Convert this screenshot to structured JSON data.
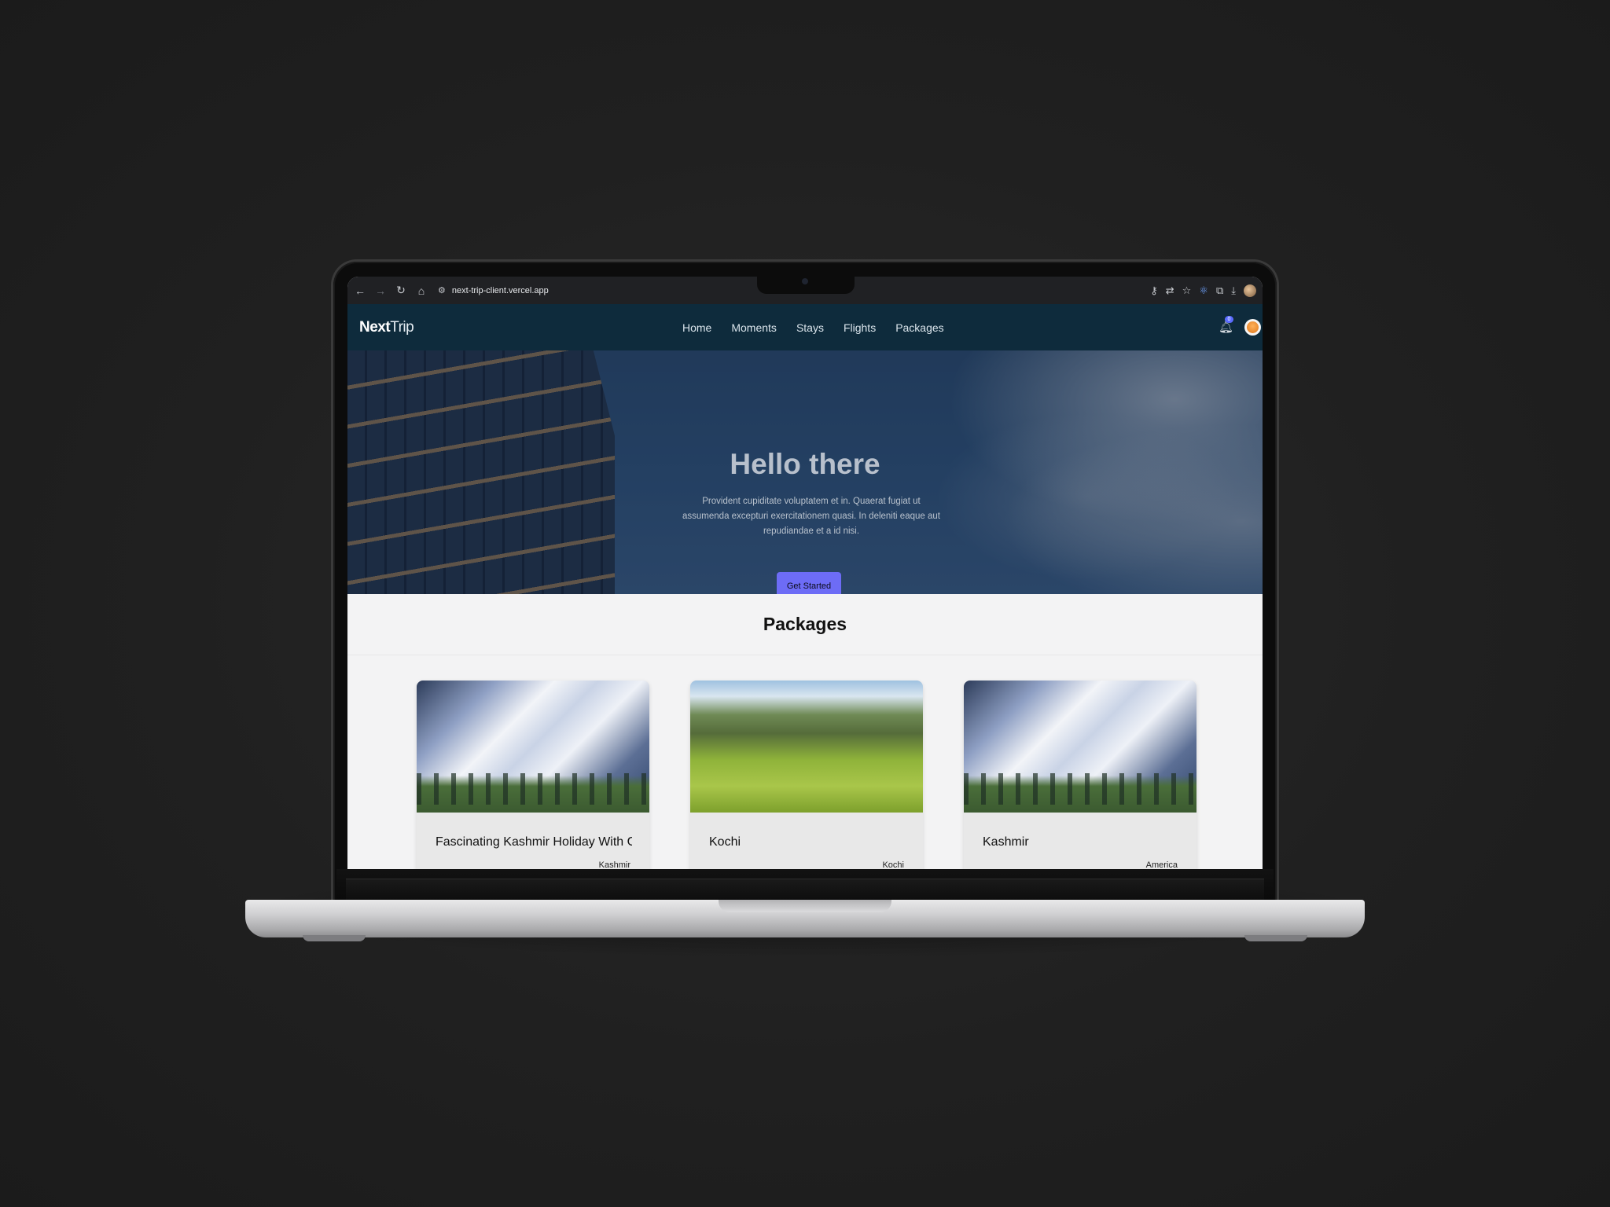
{
  "browser": {
    "url": "next-trip-client.vercel.app"
  },
  "site": {
    "logo_bold": "Next",
    "logo_light": "Trip",
    "menu": [
      "Home",
      "Moments",
      "Stays",
      "Flights",
      "Packages"
    ],
    "notification_count": "0"
  },
  "hero": {
    "title": "Hello there",
    "text": "Provident cupiditate voluptatem et in. Quaerat fugiat ut assumenda excepturi exercitationem quasi. In deleniti eaque aut repudiandae et a id nisi.",
    "button": "Get Started"
  },
  "packages": {
    "title": "Packages",
    "cards": [
      {
        "title": "Fascinating Kashmir Holiday With G",
        "location": "Kashmir",
        "image": "snowy-mountain"
      },
      {
        "title": "Kochi",
        "location": "Kochi",
        "image": "green-valley"
      },
      {
        "title": "Kashmir",
        "location": "America",
        "image": "snowy-mountain"
      }
    ]
  }
}
